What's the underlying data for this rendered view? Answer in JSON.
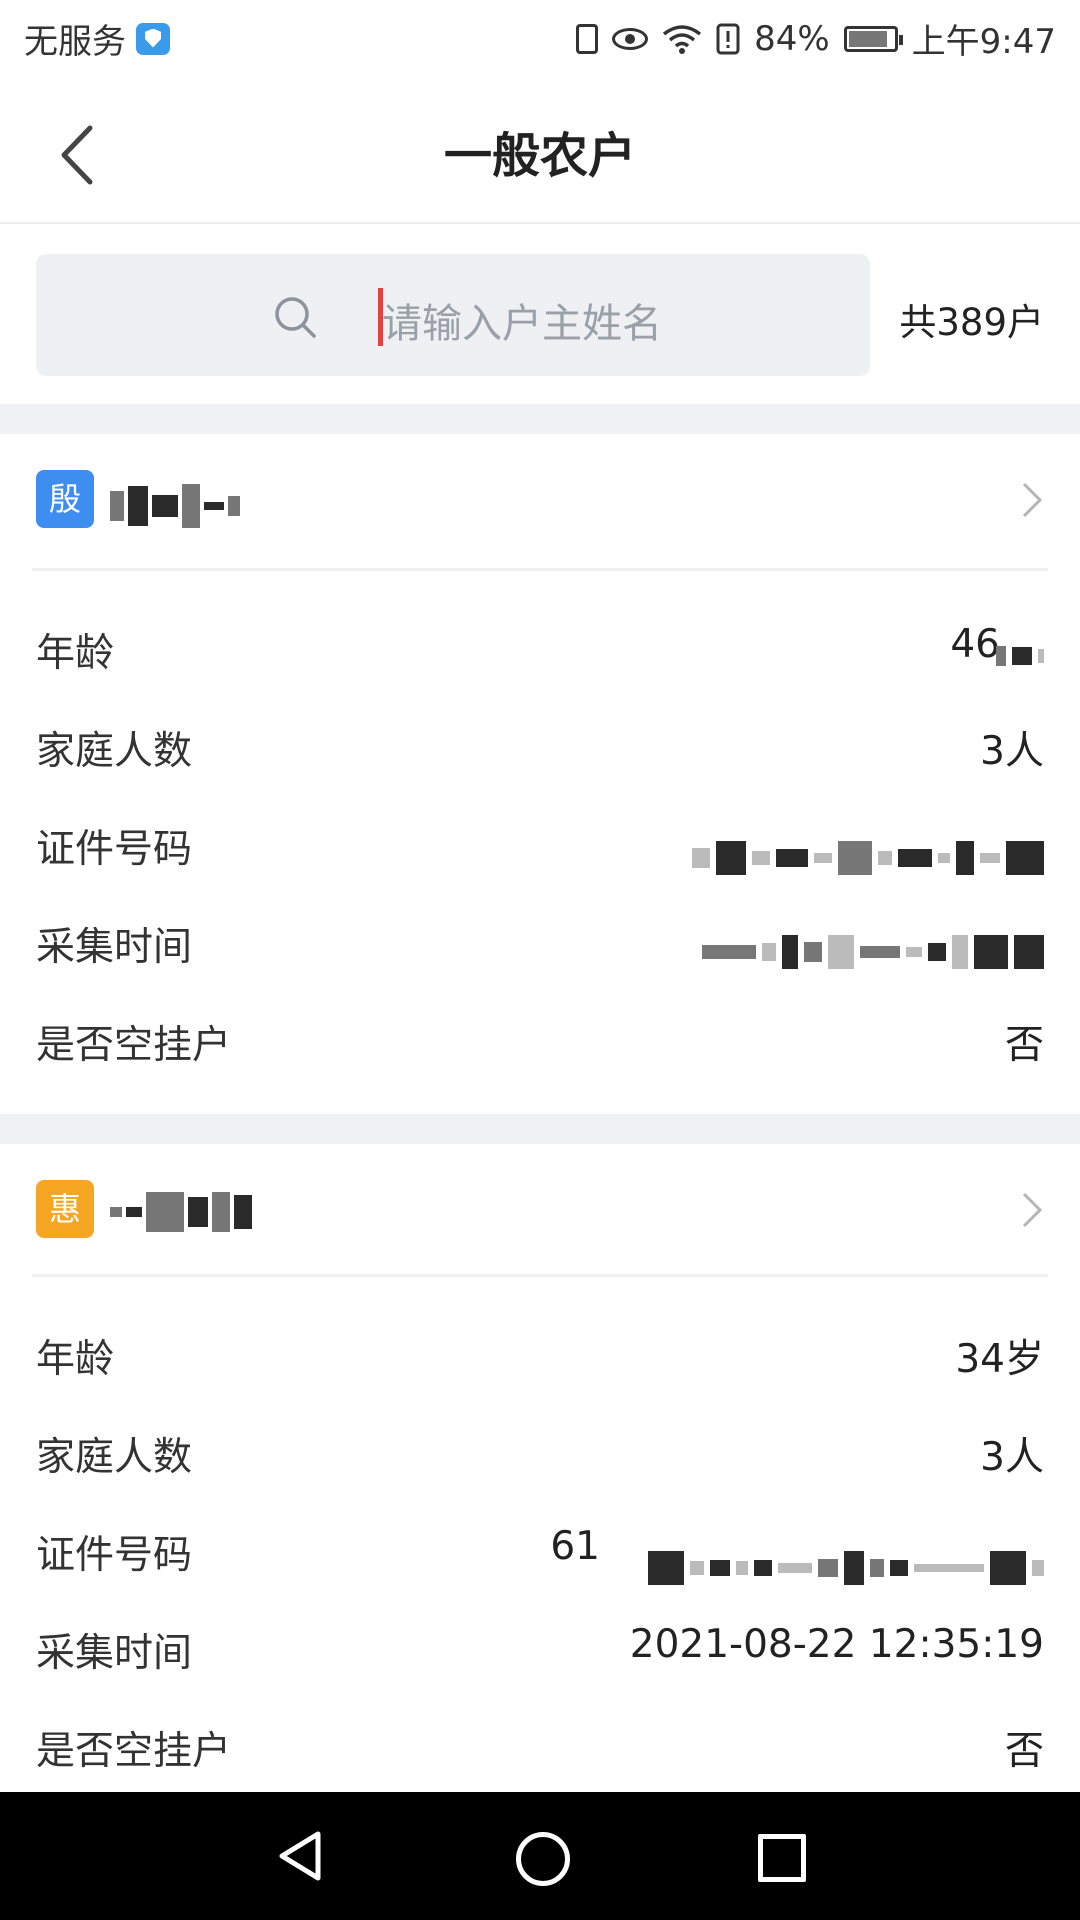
{
  "status_bar": {
    "carrier": "无服务",
    "battery_percent": "84%",
    "time": "上午9:47"
  },
  "nav": {
    "title": "一般农户"
  },
  "search": {
    "placeholder": "请输入户主姓名",
    "total": "共389户"
  },
  "households": [
    {
      "badge": "殷",
      "badge_color": "#3d8ef0",
      "rows": [
        {
          "label": "年龄",
          "value": "46"
        },
        {
          "label": "家庭人数",
          "value": "3人"
        },
        {
          "label": "证件号码",
          "value": ""
        },
        {
          "label": "采集时间",
          "value": ""
        },
        {
          "label": "是否空挂户",
          "value": "否"
        }
      ]
    },
    {
      "badge": "惠",
      "badge_color": "#f6a623",
      "rows": [
        {
          "label": "年龄",
          "value": "34岁"
        },
        {
          "label": "家庭人数",
          "value": "3人"
        },
        {
          "label": "证件号码",
          "value": "61"
        },
        {
          "label": "采集时间",
          "value": "2021-08-22 12:35:19"
        },
        {
          "label": "是否空挂户",
          "value": "否"
        }
      ]
    }
  ]
}
